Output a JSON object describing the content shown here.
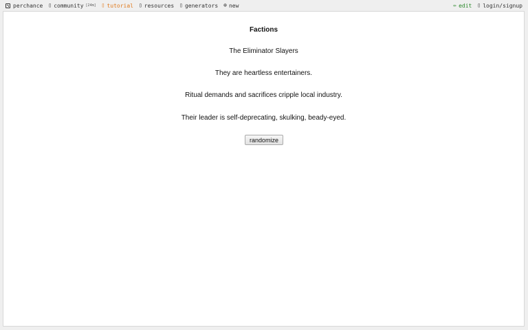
{
  "topbar": {
    "left": [
      {
        "label": "perchance",
        "icon": "die-icon"
      },
      {
        "label": "community",
        "icon": "chat-icon",
        "badge": "[24m]"
      },
      {
        "label": "tutorial",
        "icon": "book-icon"
      },
      {
        "label": "resources",
        "icon": "link-icon"
      },
      {
        "label": "generators",
        "icon": "list-icon"
      },
      {
        "label": "new",
        "icon": "plus-circle-icon",
        "glyph": "⊕"
      }
    ],
    "right": [
      {
        "label": "edit",
        "icon": "pencil-icon",
        "glyph": "✏"
      },
      {
        "label": "login/signup",
        "icon": "user-icon"
      }
    ]
  },
  "main": {
    "title": "Factions",
    "lines": [
      "The Eliminator Slayers",
      "They are heartless entertainers.",
      "Ritual demands and sacrifices cripple local industry.",
      "Their leader is self-deprecating, skulking, beady-eyed."
    ],
    "button_label": "randomize"
  },
  "colors": {
    "tutorial": "#e07b1f",
    "edit": "#2d8a2d",
    "panel_bg": "#ffffff",
    "page_bg": "#efefef"
  }
}
